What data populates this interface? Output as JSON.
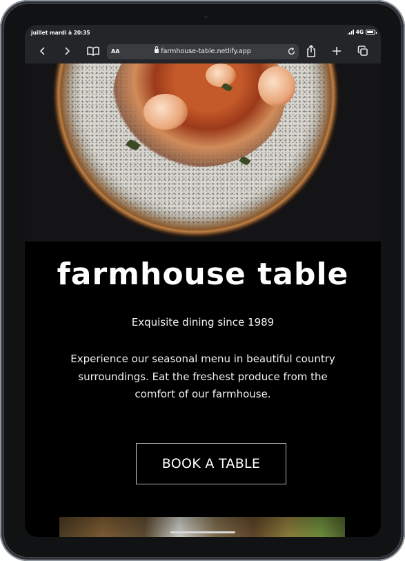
{
  "status_bar": {
    "time": "juillet mardi à 20:35",
    "network": "4G"
  },
  "browser": {
    "text_size_label": "AA",
    "url": "farmhouse-table.netlify.app",
    "icons": [
      "back-icon",
      "forward-icon",
      "bookmarks-icon",
      "lock-icon",
      "reload-icon",
      "share-icon",
      "new-tab-icon",
      "tabs-icon"
    ]
  },
  "page": {
    "title": "farmhouse table",
    "tagline": "Exquisite dining since 1989",
    "description": "Experience our seasonal menu in beautiful country surroundings. Eat the freshest produce from the comfort of our farmhouse.",
    "cta_label": "BOOK A TABLE"
  },
  "colors": {
    "background": "#000000",
    "text": "#ffffff",
    "toolbar": "#232528",
    "button_border": "#b8b8b8"
  }
}
